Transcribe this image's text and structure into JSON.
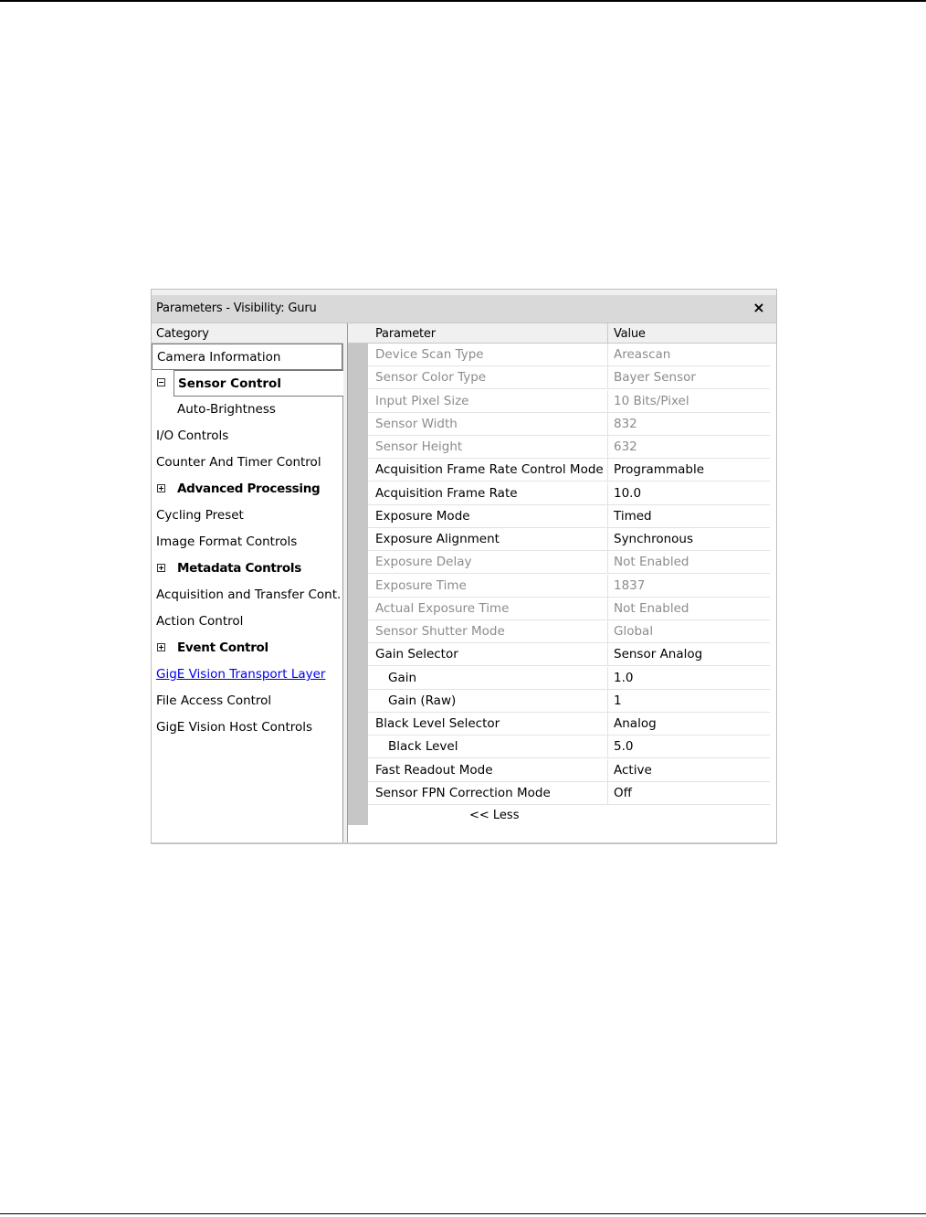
{
  "window": {
    "title": "Parameters - Visibility: Guru",
    "close_glyph": "×"
  },
  "category": {
    "header": "Category",
    "items": [
      {
        "label": "Camera Information"
      },
      {
        "label": "Sensor Control",
        "expanded": true,
        "selected": true
      },
      {
        "label": "Auto-Brightness"
      },
      {
        "label": "I/O Controls"
      },
      {
        "label": "Counter And Timer Control"
      },
      {
        "label": "Advanced Processing",
        "expandable": true
      },
      {
        "label": "Cycling Preset"
      },
      {
        "label": "Image Format Controls"
      },
      {
        "label": "Metadata Controls",
        "expandable": true
      },
      {
        "label": "Acquisition and Transfer Cont..."
      },
      {
        "label": "Action Control"
      },
      {
        "label": "Event Control",
        "expandable": true
      },
      {
        "label": "GigE Vision Transport Layer",
        "link": true
      },
      {
        "label": "File Access Control"
      },
      {
        "label": "GigE Vision Host Controls"
      }
    ]
  },
  "grid": {
    "col_parameter": "Parameter",
    "col_value": "Value",
    "rows": [
      {
        "name": "Device Scan Type",
        "value": "Areascan",
        "readonly": true
      },
      {
        "name": "Sensor Color Type",
        "value": "Bayer Sensor",
        "readonly": true
      },
      {
        "name": "Input Pixel Size",
        "value": "10 Bits/Pixel",
        "readonly": true
      },
      {
        "name": "Sensor Width",
        "value": "832",
        "readonly": true
      },
      {
        "name": "Sensor Height",
        "value": "632",
        "readonly": true
      },
      {
        "name": "Acquisition Frame Rate Control Mode",
        "value": "Programmable",
        "readonly": false
      },
      {
        "name": "Acquisition Frame Rate",
        "value": "10.0",
        "readonly": false
      },
      {
        "name": "Exposure Mode",
        "value": "Timed",
        "readonly": false
      },
      {
        "name": "Exposure Alignment",
        "value": "Synchronous",
        "readonly": false
      },
      {
        "name": "Exposure Delay",
        "value": "Not Enabled",
        "readonly": true
      },
      {
        "name": "Exposure Time",
        "value": "1837",
        "readonly": true
      },
      {
        "name": "Actual Exposure Time",
        "value": "Not Enabled",
        "readonly": true
      },
      {
        "name": "Sensor Shutter Mode",
        "value": "Global",
        "readonly": true
      },
      {
        "name": "Gain Selector",
        "value": "Sensor Analog",
        "readonly": false
      },
      {
        "name": "Gain",
        "value": "1.0",
        "readonly": false,
        "indent": true
      },
      {
        "name": "Gain (Raw)",
        "value": "1",
        "readonly": false,
        "indent": true
      },
      {
        "name": "Black Level Selector",
        "value": "Analog",
        "readonly": false
      },
      {
        "name": "Black Level",
        "value": "5.0",
        "readonly": false,
        "indent": true
      },
      {
        "name": "Fast Readout Mode",
        "value": "Active",
        "readonly": false
      },
      {
        "name": "Sensor FPN Correction Mode",
        "value": "Off",
        "readonly": false
      }
    ],
    "less_label": "<< Less"
  },
  "colors": {
    "readonly_text": "#8c8c8c",
    "link": "#0000ee",
    "gutter": "#c6c6c6",
    "titlebar": "#d9d9d9"
  }
}
